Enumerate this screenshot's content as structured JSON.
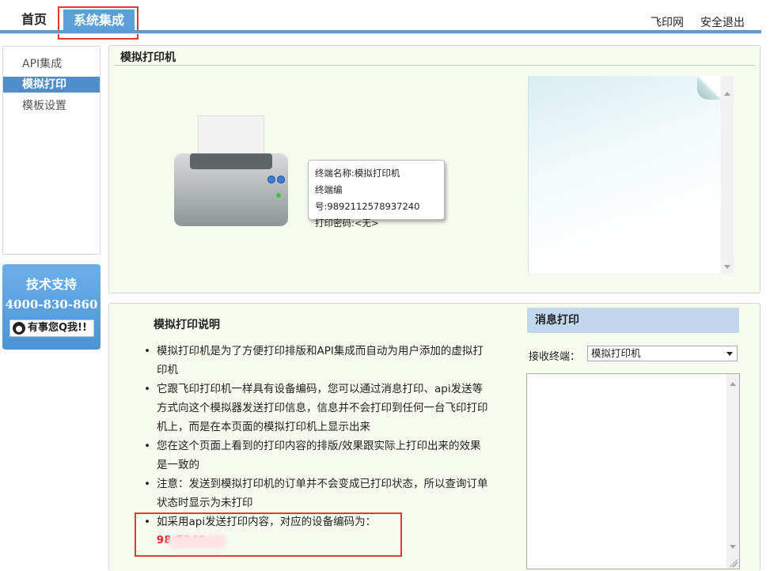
{
  "nav": {
    "home": "首页",
    "system_integration": "系统集成",
    "feiyin": "飞印网",
    "logout": "安全退出"
  },
  "sidebar": {
    "items": [
      {
        "label": "API集成",
        "active": false
      },
      {
        "label": "模拟打印",
        "active": true
      },
      {
        "label": "模板设置",
        "active": false
      }
    ]
  },
  "support": {
    "title": "技术支持",
    "phone": "4000-830-860",
    "qq_button": "有事您Q我!!"
  },
  "printer_panel": {
    "title": "模拟打印机",
    "terminal_name": "终端名称:模拟打印机",
    "terminal_id": "终端编号:9892112578937240",
    "print_password": "打印密码:<无>"
  },
  "description": {
    "title": "模拟打印说明",
    "items": [
      "模拟打印机是为了方便打印排版和API集成而自动为用户添加的虚拟打印机",
      "它跟飞印打印机一样具有设备编码，您可以通过消息打印、api发送等方式向这个模拟器发送打印信息，信息并不会打印到任何一台飞印打印机上，而是在本页面的模拟打印机上显示出来",
      "您在这个页面上看到的打印内容的排版/效果跟实际上打印出来的效果是一致的",
      "注意：发送到模拟打印机的订单并不会变成已打印状态，所以查询订单状态时显示为未打印",
      "如采用api发送打印内容，对应的设备编码为："
    ],
    "device_code": "98        7240"
  },
  "message_print": {
    "title": "消息打印",
    "receiver_label": "接收终端：",
    "receiver_selected": "模拟打印机",
    "content": ""
  },
  "colors": {
    "accent": "#5a9fd9",
    "highlight": "#e53935",
    "panel_bg": "#f5fbef",
    "code_red": "#e0262e"
  }
}
